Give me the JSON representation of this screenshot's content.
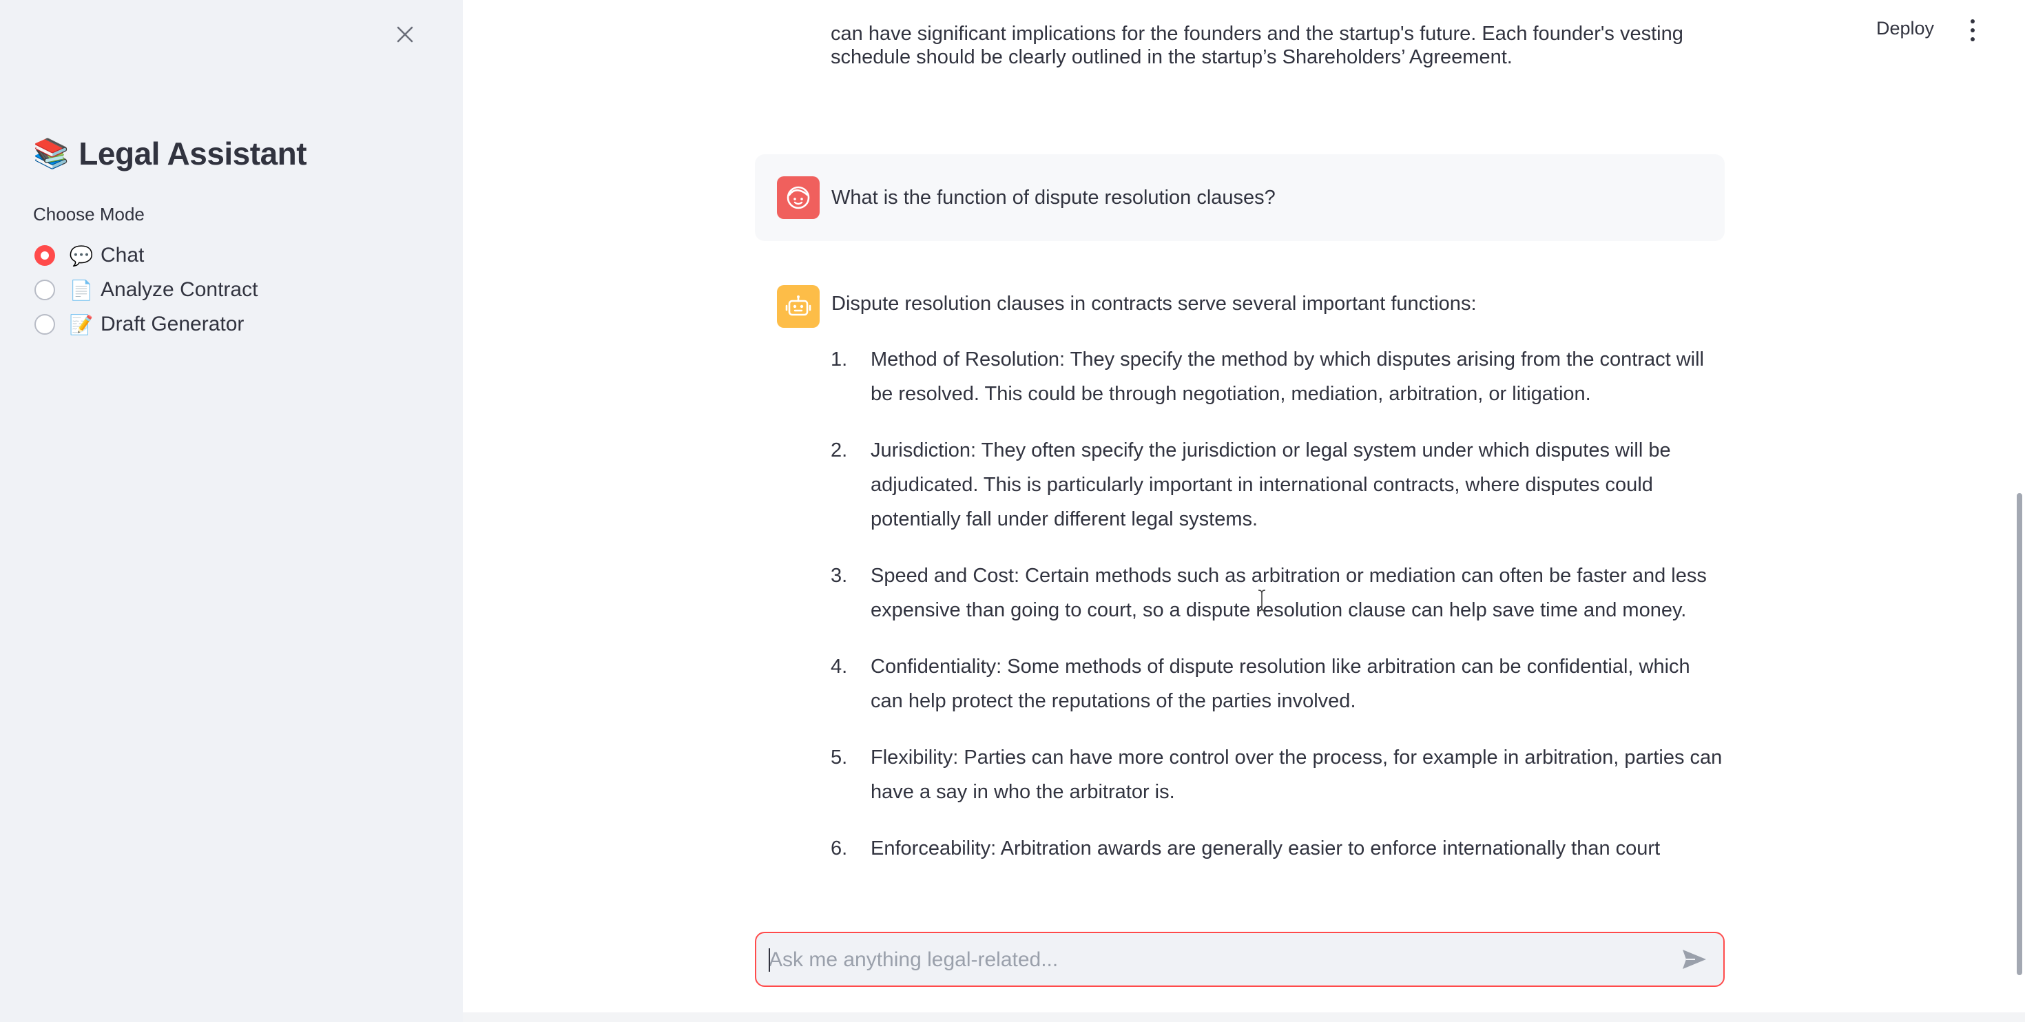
{
  "sidebar": {
    "title_emoji": "📚",
    "title": "Legal Assistant",
    "mode_label": "Choose Mode",
    "modes": [
      {
        "emoji": "💬",
        "label": "Chat",
        "selected": true
      },
      {
        "emoji": "📄",
        "label": "Analyze Contract",
        "selected": false
      },
      {
        "emoji": "📝",
        "label": "Draft Generator",
        "selected": false
      }
    ]
  },
  "header": {
    "deploy_label": "Deploy"
  },
  "chat": {
    "previous_answer_cut_line": "can have significant implications for the founders and the startup's future. Each founder's vesting",
    "previous_answer_tail": "schedule should be clearly outlined in the startup’s Shareholders’ Agreement.",
    "user_message": "What is the function of dispute resolution clauses?",
    "bot_intro": "Dispute resolution clauses in contracts serve several important functions:",
    "bot_list": [
      {
        "num": "1.",
        "text": "Method of Resolution: They specify the method by which disputes arising from the contract will be resolved. This could be through negotiation, mediation, arbitration, or litigation."
      },
      {
        "num": "2.",
        "text": "Jurisdiction: They often specify the jurisdiction or legal system under which disputes will be adjudicated. This is particularly important in international contracts, where disputes could potentially fall under different legal systems."
      },
      {
        "num": "3.",
        "text": "Speed and Cost: Certain methods such as arbitration or mediation can often be faster and less expensive than going to court, so a dispute resolution clause can help save time and money."
      },
      {
        "num": "4.",
        "text": "Confidentiality: Some methods of dispute resolution like arbitration can be confidential, which can help protect the reputations of the parties involved."
      },
      {
        "num": "5.",
        "text": "Flexibility: Parties can have more control over the process, for example in arbitration, parties can have a say in who the arbitrator is."
      },
      {
        "num": "6.",
        "text": "Enforceability: Arbitration awards are generally easier to enforce internationally than court"
      }
    ]
  },
  "input": {
    "placeholder": "Ask me anything legal-related...",
    "value": ""
  },
  "colors": {
    "accent": "#ff4b4b",
    "sidebar_bg": "#f0f2f6",
    "user_avatar": "#f0605d",
    "bot_avatar": "#fdbd48",
    "text": "#31333f"
  }
}
